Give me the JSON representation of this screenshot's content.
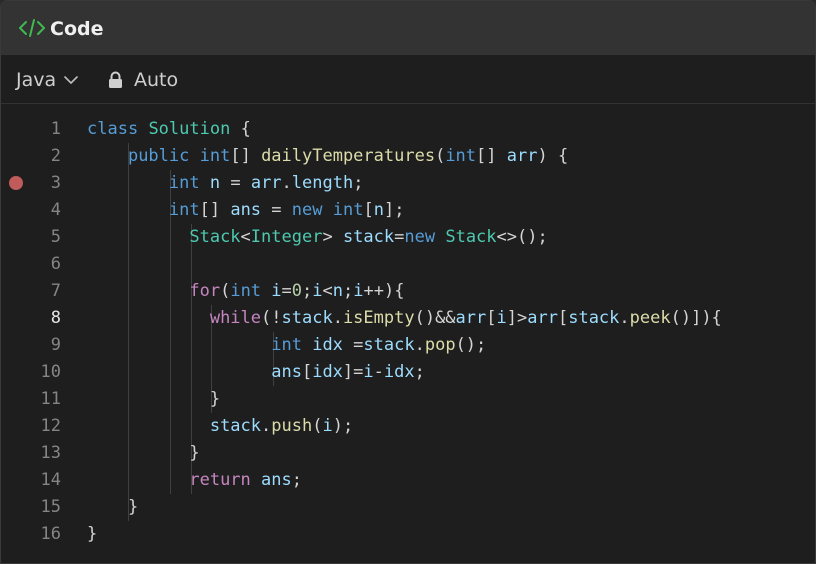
{
  "title": "Code",
  "toolbar": {
    "language": "Java",
    "mode": "Auto"
  },
  "icons": {
    "code": "code-brackets-icon",
    "chevron": "chevron-down-icon",
    "lock": "lock-icon"
  },
  "colors": {
    "accent_green": "#3fb950",
    "breakpoint": "#c05b5b",
    "keyword": "#569cd6",
    "control": "#c586c0",
    "type": "#4ec9b0",
    "function": "#dcdcaa",
    "variable": "#9cdcfe",
    "number": "#b5cea8"
  },
  "editor": {
    "active_line": 8,
    "breakpoint_line": 3,
    "lines": [
      {
        "n": "1",
        "text": "class Solution {"
      },
      {
        "n": "2",
        "text": "    public int[] dailyTemperatures(int[] arr) {"
      },
      {
        "n": "3",
        "text": "        int n = arr.length;"
      },
      {
        "n": "4",
        "text": "        int[] ans = new int[n];"
      },
      {
        "n": "5",
        "text": "          Stack<Integer> stack=new Stack<>();"
      },
      {
        "n": "6",
        "text": ""
      },
      {
        "n": "7",
        "text": "          for(int i=0;i<n;i++){"
      },
      {
        "n": "8",
        "text": "            while(!stack.isEmpty()&&arr[i]>arr[stack.peek()]){"
      },
      {
        "n": "9",
        "text": "                  int idx =stack.pop();"
      },
      {
        "n": "10",
        "text": "                  ans[idx]=i-idx;"
      },
      {
        "n": "11",
        "text": "            }"
      },
      {
        "n": "12",
        "text": "            stack.push(i);"
      },
      {
        "n": "13",
        "text": "          }"
      },
      {
        "n": "14",
        "text": "          return ans;"
      },
      {
        "n": "15",
        "text": "    }"
      },
      {
        "n": "16",
        "text": "}"
      }
    ]
  }
}
